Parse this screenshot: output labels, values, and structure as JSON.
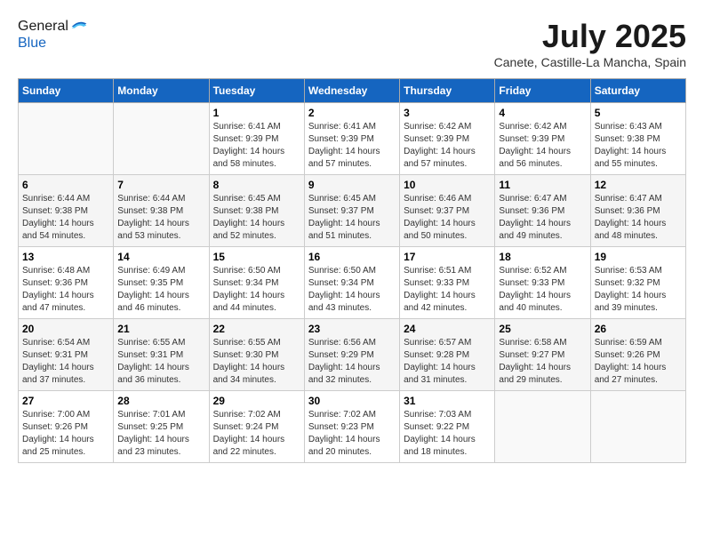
{
  "header": {
    "logo_line1": "General",
    "logo_line2": "Blue",
    "month_year": "July 2025",
    "location": "Canete, Castille-La Mancha, Spain"
  },
  "weekdays": [
    "Sunday",
    "Monday",
    "Tuesday",
    "Wednesday",
    "Thursday",
    "Friday",
    "Saturday"
  ],
  "weeks": [
    [
      {
        "day": "",
        "sunrise": "",
        "sunset": "",
        "daylight": ""
      },
      {
        "day": "",
        "sunrise": "",
        "sunset": "",
        "daylight": ""
      },
      {
        "day": "1",
        "sunrise": "Sunrise: 6:41 AM",
        "sunset": "Sunset: 9:39 PM",
        "daylight": "Daylight: 14 hours and 58 minutes."
      },
      {
        "day": "2",
        "sunrise": "Sunrise: 6:41 AM",
        "sunset": "Sunset: 9:39 PM",
        "daylight": "Daylight: 14 hours and 57 minutes."
      },
      {
        "day": "3",
        "sunrise": "Sunrise: 6:42 AM",
        "sunset": "Sunset: 9:39 PM",
        "daylight": "Daylight: 14 hours and 57 minutes."
      },
      {
        "day": "4",
        "sunrise": "Sunrise: 6:42 AM",
        "sunset": "Sunset: 9:39 PM",
        "daylight": "Daylight: 14 hours and 56 minutes."
      },
      {
        "day": "5",
        "sunrise": "Sunrise: 6:43 AM",
        "sunset": "Sunset: 9:38 PM",
        "daylight": "Daylight: 14 hours and 55 minutes."
      }
    ],
    [
      {
        "day": "6",
        "sunrise": "Sunrise: 6:44 AM",
        "sunset": "Sunset: 9:38 PM",
        "daylight": "Daylight: 14 hours and 54 minutes."
      },
      {
        "day": "7",
        "sunrise": "Sunrise: 6:44 AM",
        "sunset": "Sunset: 9:38 PM",
        "daylight": "Daylight: 14 hours and 53 minutes."
      },
      {
        "day": "8",
        "sunrise": "Sunrise: 6:45 AM",
        "sunset": "Sunset: 9:38 PM",
        "daylight": "Daylight: 14 hours and 52 minutes."
      },
      {
        "day": "9",
        "sunrise": "Sunrise: 6:45 AM",
        "sunset": "Sunset: 9:37 PM",
        "daylight": "Daylight: 14 hours and 51 minutes."
      },
      {
        "day": "10",
        "sunrise": "Sunrise: 6:46 AM",
        "sunset": "Sunset: 9:37 PM",
        "daylight": "Daylight: 14 hours and 50 minutes."
      },
      {
        "day": "11",
        "sunrise": "Sunrise: 6:47 AM",
        "sunset": "Sunset: 9:36 PM",
        "daylight": "Daylight: 14 hours and 49 minutes."
      },
      {
        "day": "12",
        "sunrise": "Sunrise: 6:47 AM",
        "sunset": "Sunset: 9:36 PM",
        "daylight": "Daylight: 14 hours and 48 minutes."
      }
    ],
    [
      {
        "day": "13",
        "sunrise": "Sunrise: 6:48 AM",
        "sunset": "Sunset: 9:36 PM",
        "daylight": "Daylight: 14 hours and 47 minutes."
      },
      {
        "day": "14",
        "sunrise": "Sunrise: 6:49 AM",
        "sunset": "Sunset: 9:35 PM",
        "daylight": "Daylight: 14 hours and 46 minutes."
      },
      {
        "day": "15",
        "sunrise": "Sunrise: 6:50 AM",
        "sunset": "Sunset: 9:34 PM",
        "daylight": "Daylight: 14 hours and 44 minutes."
      },
      {
        "day": "16",
        "sunrise": "Sunrise: 6:50 AM",
        "sunset": "Sunset: 9:34 PM",
        "daylight": "Daylight: 14 hours and 43 minutes."
      },
      {
        "day": "17",
        "sunrise": "Sunrise: 6:51 AM",
        "sunset": "Sunset: 9:33 PM",
        "daylight": "Daylight: 14 hours and 42 minutes."
      },
      {
        "day": "18",
        "sunrise": "Sunrise: 6:52 AM",
        "sunset": "Sunset: 9:33 PM",
        "daylight": "Daylight: 14 hours and 40 minutes."
      },
      {
        "day": "19",
        "sunrise": "Sunrise: 6:53 AM",
        "sunset": "Sunset: 9:32 PM",
        "daylight": "Daylight: 14 hours and 39 minutes."
      }
    ],
    [
      {
        "day": "20",
        "sunrise": "Sunrise: 6:54 AM",
        "sunset": "Sunset: 9:31 PM",
        "daylight": "Daylight: 14 hours and 37 minutes."
      },
      {
        "day": "21",
        "sunrise": "Sunrise: 6:55 AM",
        "sunset": "Sunset: 9:31 PM",
        "daylight": "Daylight: 14 hours and 36 minutes."
      },
      {
        "day": "22",
        "sunrise": "Sunrise: 6:55 AM",
        "sunset": "Sunset: 9:30 PM",
        "daylight": "Daylight: 14 hours and 34 minutes."
      },
      {
        "day": "23",
        "sunrise": "Sunrise: 6:56 AM",
        "sunset": "Sunset: 9:29 PM",
        "daylight": "Daylight: 14 hours and 32 minutes."
      },
      {
        "day": "24",
        "sunrise": "Sunrise: 6:57 AM",
        "sunset": "Sunset: 9:28 PM",
        "daylight": "Daylight: 14 hours and 31 minutes."
      },
      {
        "day": "25",
        "sunrise": "Sunrise: 6:58 AM",
        "sunset": "Sunset: 9:27 PM",
        "daylight": "Daylight: 14 hours and 29 minutes."
      },
      {
        "day": "26",
        "sunrise": "Sunrise: 6:59 AM",
        "sunset": "Sunset: 9:26 PM",
        "daylight": "Daylight: 14 hours and 27 minutes."
      }
    ],
    [
      {
        "day": "27",
        "sunrise": "Sunrise: 7:00 AM",
        "sunset": "Sunset: 9:26 PM",
        "daylight": "Daylight: 14 hours and 25 minutes."
      },
      {
        "day": "28",
        "sunrise": "Sunrise: 7:01 AM",
        "sunset": "Sunset: 9:25 PM",
        "daylight": "Daylight: 14 hours and 23 minutes."
      },
      {
        "day": "29",
        "sunrise": "Sunrise: 7:02 AM",
        "sunset": "Sunset: 9:24 PM",
        "daylight": "Daylight: 14 hours and 22 minutes."
      },
      {
        "day": "30",
        "sunrise": "Sunrise: 7:02 AM",
        "sunset": "Sunset: 9:23 PM",
        "daylight": "Daylight: 14 hours and 20 minutes."
      },
      {
        "day": "31",
        "sunrise": "Sunrise: 7:03 AM",
        "sunset": "Sunset: 9:22 PM",
        "daylight": "Daylight: 14 hours and 18 minutes."
      },
      {
        "day": "",
        "sunrise": "",
        "sunset": "",
        "daylight": ""
      },
      {
        "day": "",
        "sunrise": "",
        "sunset": "",
        "daylight": ""
      }
    ]
  ]
}
